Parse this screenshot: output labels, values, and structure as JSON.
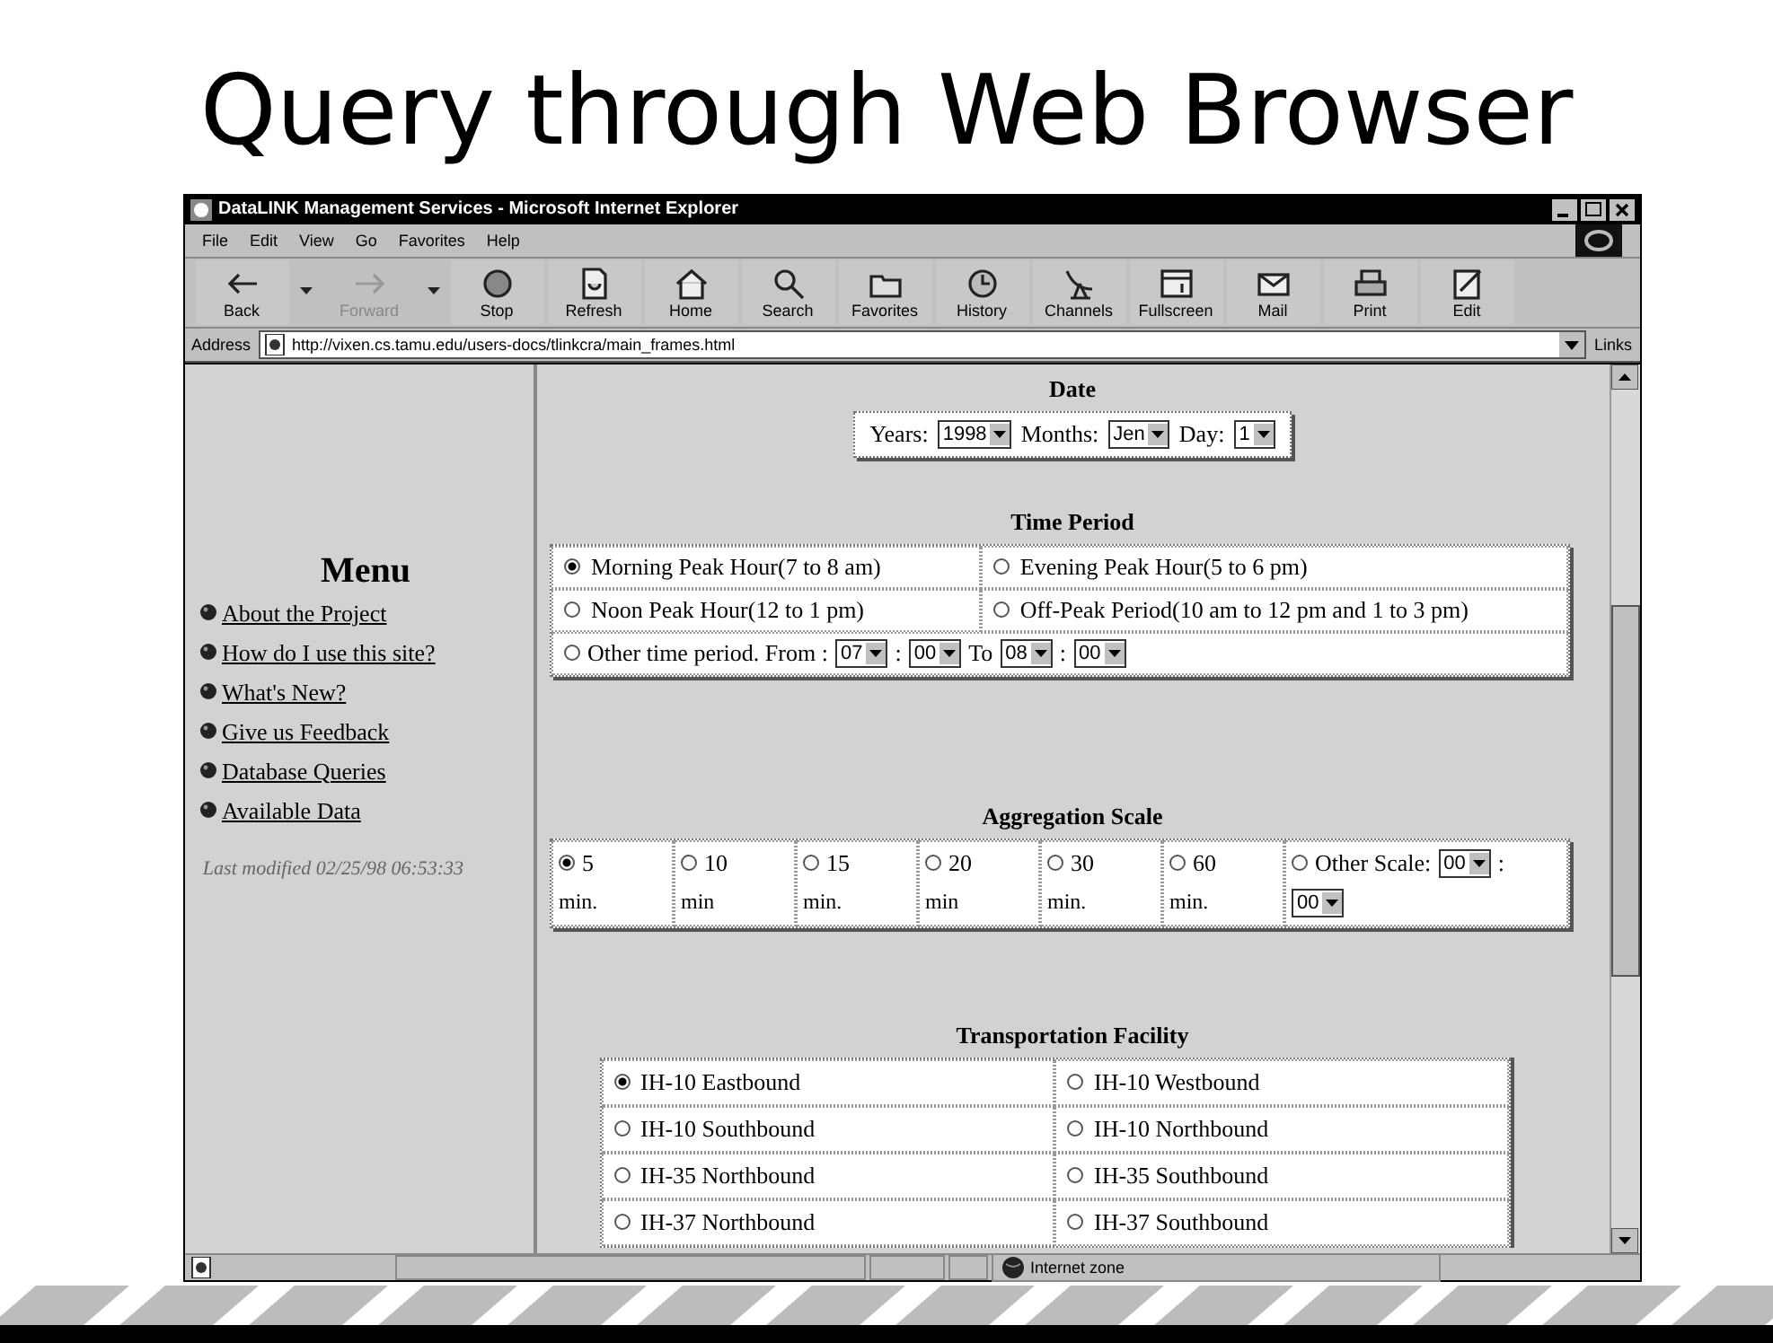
{
  "slide_title": "Query through Web Browser",
  "browser": {
    "window_title": "DataLINK Management Services - Microsoft Internet Explorer",
    "menu": [
      "File",
      "Edit",
      "View",
      "Go",
      "Favorites",
      "Help"
    ],
    "toolbar": [
      {
        "kind": "back",
        "label": "Back",
        "disabled": false,
        "dropdown": true
      },
      {
        "kind": "forward",
        "label": "Forward",
        "disabled": true,
        "dropdown": true
      },
      {
        "kind": "stop",
        "label": "Stop",
        "disabled": false,
        "dropdown": false
      },
      {
        "kind": "refresh",
        "label": "Refresh",
        "disabled": false,
        "dropdown": false
      },
      {
        "kind": "home",
        "label": "Home",
        "disabled": false,
        "dropdown": false
      },
      {
        "kind": "search",
        "label": "Search",
        "disabled": false,
        "dropdown": false
      },
      {
        "kind": "favorites",
        "label": "Favorites",
        "disabled": false,
        "dropdown": false
      },
      {
        "kind": "history",
        "label": "History",
        "disabled": false,
        "dropdown": false
      },
      {
        "kind": "channels",
        "label": "Channels",
        "disabled": false,
        "dropdown": false
      },
      {
        "kind": "fullscreen",
        "label": "Fullscreen",
        "disabled": false,
        "dropdown": false
      },
      {
        "kind": "mail",
        "label": "Mail",
        "disabled": false,
        "dropdown": false
      },
      {
        "kind": "print",
        "label": "Print",
        "disabled": false,
        "dropdown": false
      },
      {
        "kind": "edit",
        "label": "Edit",
        "disabled": false,
        "dropdown": false
      }
    ],
    "address": {
      "label": "Address",
      "url": "http://vixen.cs.tamu.edu/users-docs/tlinkcra/main_frames.html",
      "links_label": "Links"
    },
    "status_bar": {
      "zone": "Internet zone"
    }
  },
  "left_frame": {
    "heading": "Menu",
    "links": [
      "About the Project",
      "How do I use this site?",
      "What's New?",
      "Give us Feedback",
      "Database Queries",
      "Available Data"
    ],
    "last_modified": "Last modified 02/25/98 06:53:33"
  },
  "date": {
    "heading": "Date",
    "fields": [
      {
        "label": "Years:",
        "value": "1998"
      },
      {
        "label": "Months:",
        "value": "Jen"
      },
      {
        "label": "Day:",
        "value": "1"
      }
    ]
  },
  "time_period": {
    "heading": "Time Period",
    "options": [
      {
        "label": "Morning Peak Hour(7 to 8 am)",
        "selected": true
      },
      {
        "label": "Evening Peak Hour(5 to 6 pm)",
        "selected": false
      },
      {
        "label": "Noon Peak Hour(12 to 1 pm)",
        "selected": false
      },
      {
        "label": "Off-Peak Period(10 am to 12 pm and 1 to 3 pm)",
        "selected": false
      }
    ],
    "other": {
      "label": "Other time period. From :",
      "selected": false,
      "from_hour": "07",
      "from_sep": ":",
      "from_min": "00",
      "to_label": "To",
      "to_hour": "08",
      "to_sep": ":",
      "to_min": "00"
    }
  },
  "aggregation": {
    "heading": "Aggregation Scale",
    "options": [
      {
        "value": "5",
        "unit": "min.",
        "selected": true
      },
      {
        "value": "10",
        "unit": "min",
        "selected": false
      },
      {
        "value": "15",
        "unit": "min.",
        "selected": false
      },
      {
        "value": "20",
        "unit": "min",
        "selected": false
      },
      {
        "value": "30",
        "unit": "min.",
        "selected": false
      },
      {
        "value": "60",
        "unit": "min.",
        "selected": false
      }
    ],
    "other": {
      "label": "Other Scale:",
      "selected": false,
      "first": "00",
      "sep": ":",
      "second": "00"
    }
  },
  "facility": {
    "heading": "Transportation Facility",
    "options": [
      {
        "label": "IH-10 Eastbound",
        "selected": true
      },
      {
        "label": "IH-10 Westbound",
        "selected": false
      },
      {
        "label": "IH-10 Southbound",
        "selected": false
      },
      {
        "label": "IH-10 Northbound",
        "selected": false
      },
      {
        "label": "IH-35 Northbound",
        "selected": false
      },
      {
        "label": "IH-35 Southbound",
        "selected": false
      },
      {
        "label": "IH-37 Northbound",
        "selected": false
      },
      {
        "label": "IH-37 Southbound",
        "selected": false
      }
    ]
  }
}
